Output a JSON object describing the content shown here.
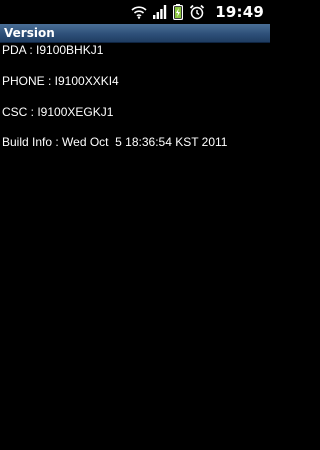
{
  "status_bar": {
    "time": "19:49",
    "icons": [
      "wifi-icon",
      "signal-icon",
      "battery-charging-icon",
      "alarm-icon"
    ],
    "accent_battery": "#8cc63f"
  },
  "title_bar": {
    "title": "Version"
  },
  "info": {
    "pda": "PDA : I9100BHKJ1",
    "phone": "PHONE : I9100XXKI4",
    "csc": "CSC : I9100XEGKJ1",
    "build": "Build Info : Wed Oct  5 18:36:54 KST 2011"
  }
}
